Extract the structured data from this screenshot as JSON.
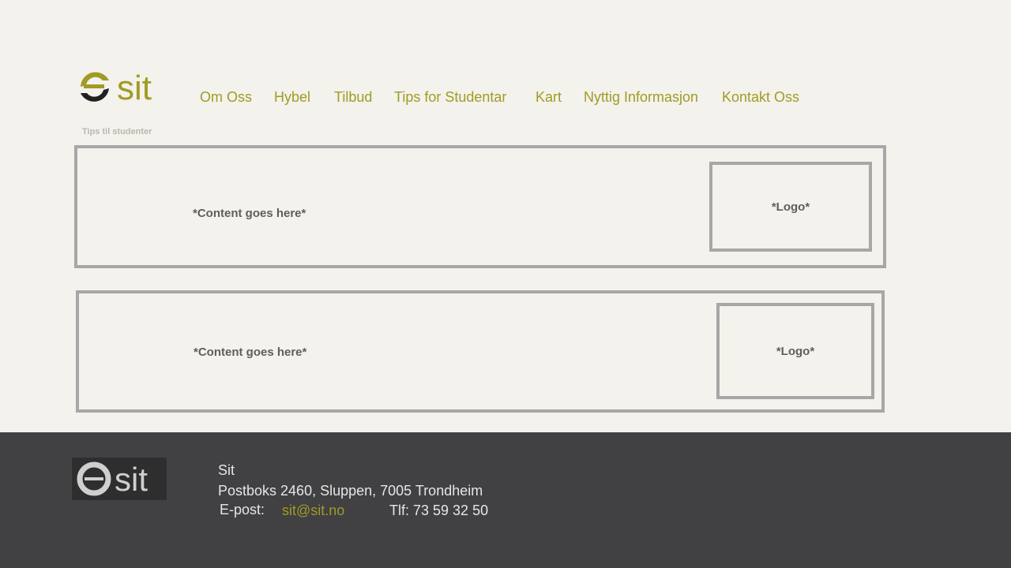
{
  "brand": {
    "logo_text": "sit",
    "accent_color": "#a09b25"
  },
  "nav": {
    "items": [
      {
        "label": "Om Oss"
      },
      {
        "label": "Hybel"
      },
      {
        "label": "Tilbud"
      },
      {
        "label": "Tips for Studentar"
      },
      {
        "label": "Kart"
      },
      {
        "label": "Nyttig Informasjon"
      },
      {
        "label": "Kontakt Oss"
      }
    ]
  },
  "breadcrumb": "Tips til studenter",
  "cards": [
    {
      "content": "*Content goes here*",
      "logo": "*Logo*"
    },
    {
      "content": "*Content goes here*",
      "logo": "*Logo*"
    }
  ],
  "footer": {
    "logo_text": "sit",
    "name": "Sit",
    "address": "Postboks 2460, Sluppen, 7005 Trondheim",
    "email_label": "E-post:",
    "email": "sit@sit.no",
    "phone": "Tlf: 73 59 32 50"
  }
}
